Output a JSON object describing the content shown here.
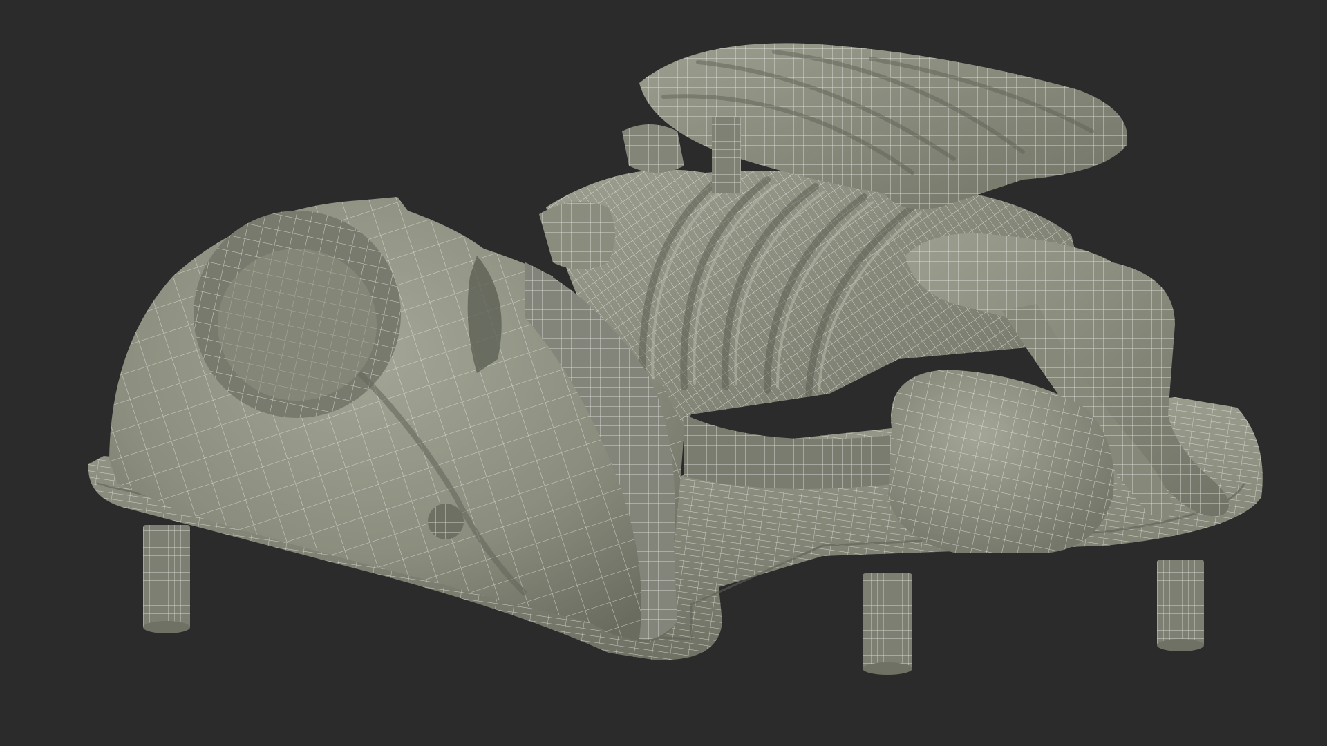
{
  "scene": {
    "background_color": "#2b2b2b",
    "mesh_fill_color": "#8b8d7e",
    "mesh_shadow_color": "#6d6f62",
    "mesh_highlight_color": "#a9ab9c",
    "wireframe_color": "#eeeeea",
    "subject": "wireframe-3d-model"
  }
}
